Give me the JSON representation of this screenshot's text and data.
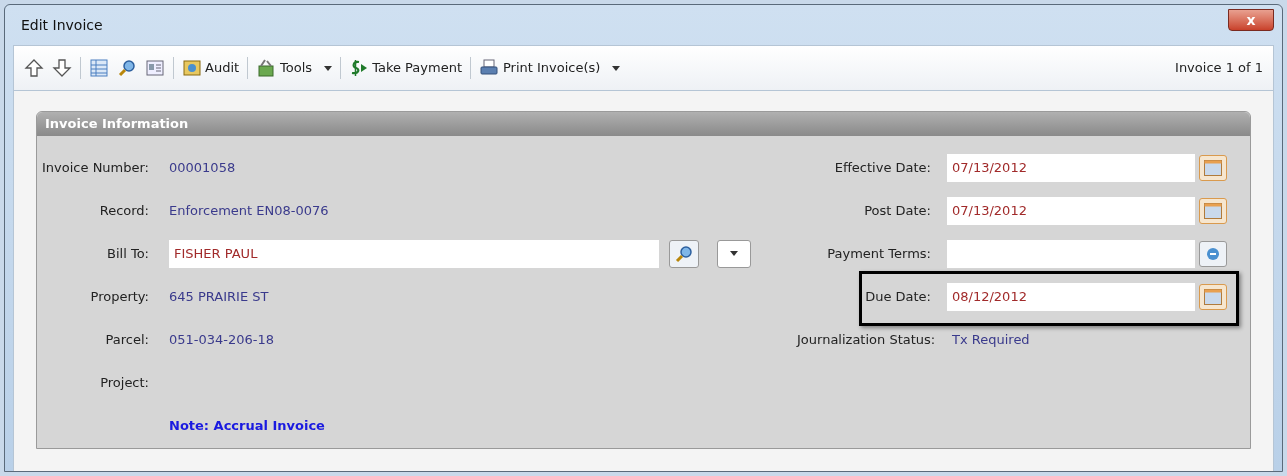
{
  "window": {
    "title": "Edit Invoice",
    "close": "x"
  },
  "toolbar": {
    "items": [
      {
        "kind": "icon"
      },
      {
        "kind": "icon"
      },
      {
        "kind": "sep"
      },
      {
        "kind": "icon"
      },
      {
        "kind": "icon"
      },
      {
        "kind": "icon"
      },
      {
        "kind": "sep"
      },
      {
        "kind": "button",
        "label": "Audit"
      },
      {
        "kind": "sep"
      },
      {
        "kind": "menu",
        "label": "Tools"
      },
      {
        "kind": "sep"
      },
      {
        "kind": "button",
        "label": "Take Payment"
      },
      {
        "kind": "sep"
      },
      {
        "kind": "menu",
        "label": "Print Invoice(s)"
      }
    ],
    "counter": "Invoice 1 of 1"
  },
  "panel": {
    "title": "Invoice Information",
    "left_fields": [
      {
        "label": "Invoice Number:",
        "kind": "text",
        "value": "00001058"
      },
      {
        "label": "Record:",
        "kind": "text",
        "value": "Enforcement EN08-0076"
      },
      {
        "label": "Bill To:",
        "kind": "lookup",
        "value": "FISHER PAUL"
      },
      {
        "label": "Property:",
        "kind": "text",
        "value": "645 PRAIRIE ST"
      },
      {
        "label": "Parcel:",
        "kind": "text",
        "value": "051-034-206-18"
      },
      {
        "label": "Project:",
        "kind": "text"
      }
    ],
    "note": "Note: Accrual Invoice",
    "right_fields": [
      {
        "label": "Effective Date:",
        "kind": "date",
        "value": "07/13/2012",
        "highlighted": false
      },
      {
        "label": "Post Date:",
        "kind": "date",
        "value": "07/13/2012",
        "highlighted": false
      },
      {
        "label": "Payment Terms:",
        "kind": "picker",
        "highlighted": false
      },
      {
        "label": "Due Date:",
        "kind": "date",
        "value": "08/12/2012",
        "highlighted": true
      },
      {
        "label": "Journalization Status:",
        "kind": "text",
        "value": "Tx Required",
        "highlighted": false
      }
    ]
  }
}
